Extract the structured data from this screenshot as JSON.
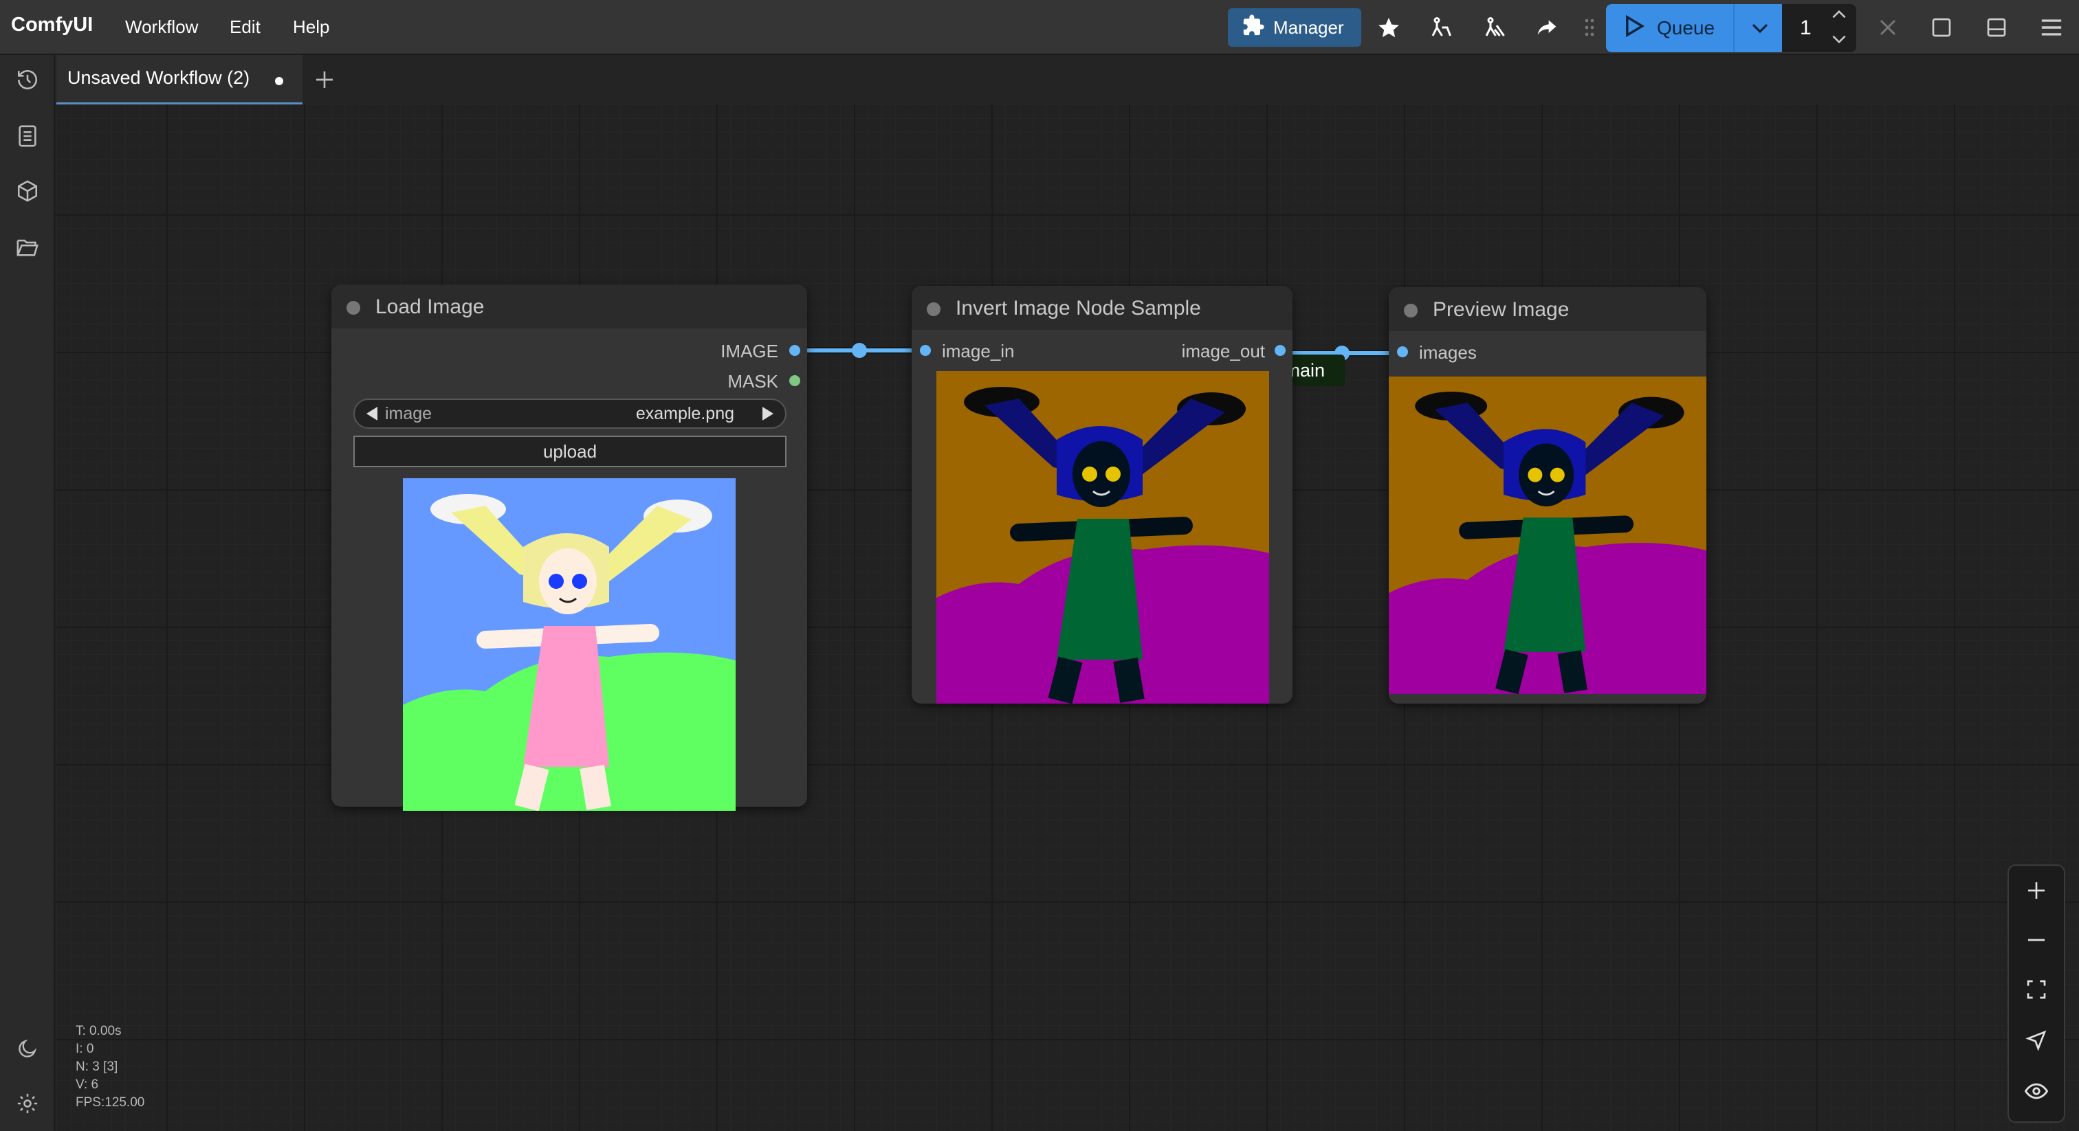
{
  "app": {
    "brand": "ComfyUI",
    "menu": [
      "Workflow",
      "Edit",
      "Help"
    ]
  },
  "toolbar": {
    "manager_label": "Manager",
    "queue_label": "Queue",
    "queue_count": "1"
  },
  "tab": {
    "label": "Unsaved Workflow (2)"
  },
  "group": {
    "title": "comfyui-invert-image-main"
  },
  "nodes": {
    "load_image": {
      "title": "Load Image",
      "outputs": [
        "IMAGE",
        "MASK"
      ],
      "widget_name": "image",
      "widget_value": "example.png",
      "upload_label": "upload"
    },
    "invert": {
      "title": "Invert Image Node Sample",
      "input": "image_in",
      "output": "image_out"
    },
    "preview": {
      "title": "Preview Image",
      "input": "images"
    }
  },
  "stats": {
    "t": "T: 0.00s",
    "i": "I: 0",
    "n": "N: 3 [3]",
    "v": "V: 6",
    "fps": "FPS:125.00"
  },
  "colors": {
    "accent": "#3a8ee6",
    "manager": "#2c5d8a",
    "link_image": "#64b5f6",
    "link_mask": "#81c784",
    "group_label_bg": "#10260f"
  }
}
